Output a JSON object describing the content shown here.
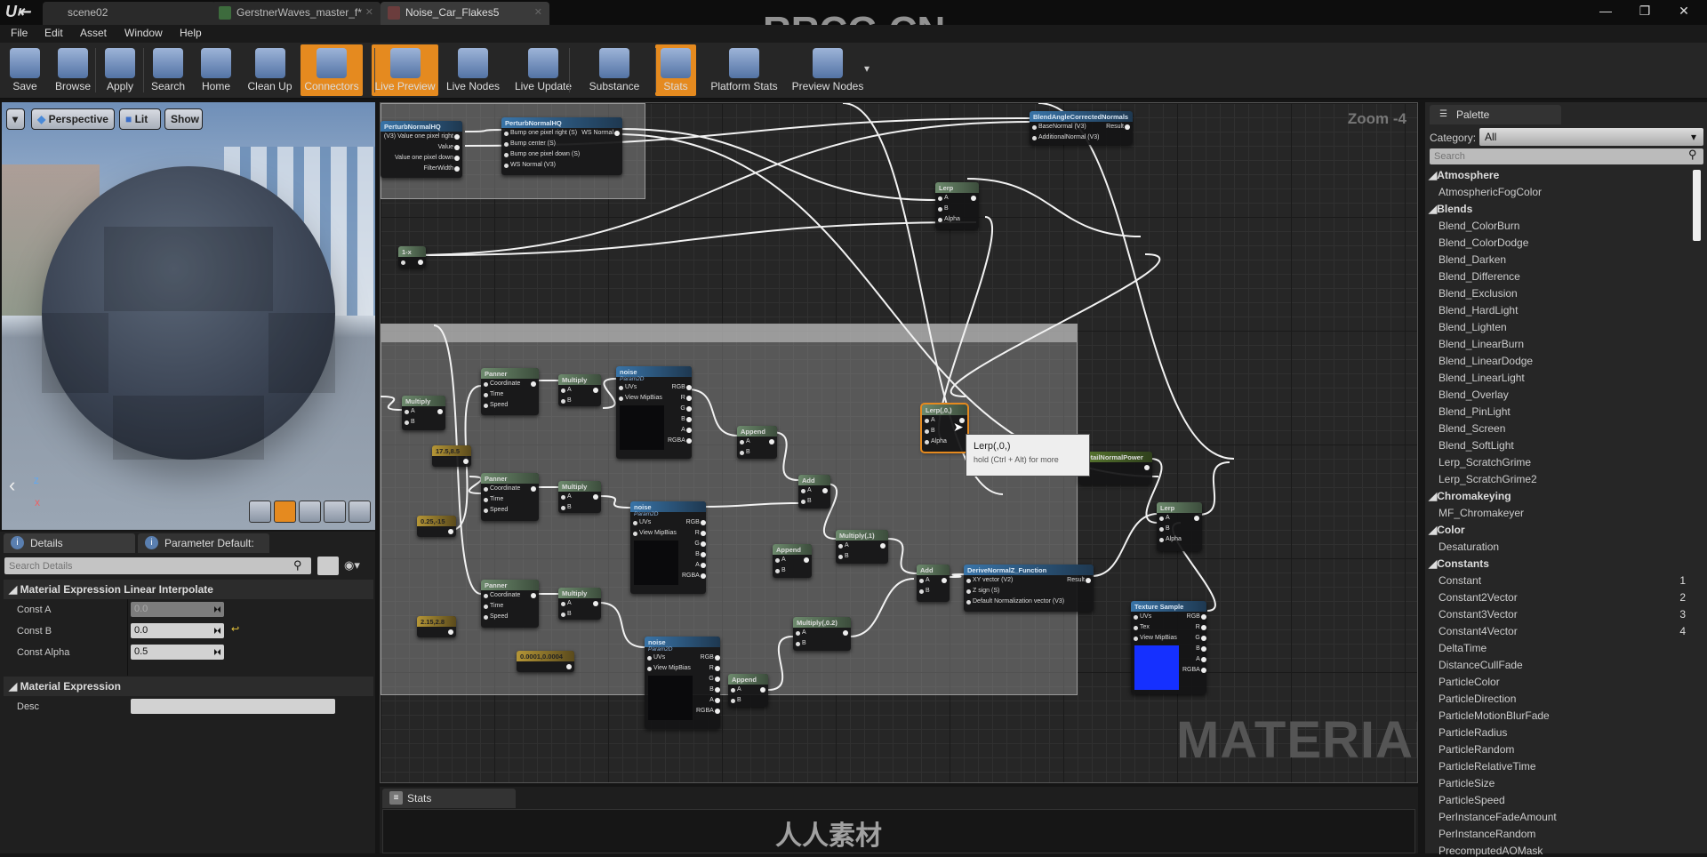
{
  "tabs": [
    {
      "label": "scene02"
    },
    {
      "label": "GerstnerWaves_master_f*"
    },
    {
      "label": "Noise_Car_Flakes5"
    }
  ],
  "window_controls": {
    "minimize": "—",
    "restore": "❐",
    "close": "✕"
  },
  "menu": [
    "File",
    "Edit",
    "Asset",
    "Window",
    "Help"
  ],
  "toolbar": [
    {
      "label": "Save",
      "icon": "save-icon",
      "active": false
    },
    {
      "label": "Browse",
      "icon": "browse-icon",
      "active": false
    },
    {
      "label": "Apply",
      "icon": "apply-check-icon",
      "active": false
    },
    {
      "label": "Search",
      "icon": "binoculars-icon",
      "active": false
    },
    {
      "label": "Home",
      "icon": "home-icon",
      "active": false
    },
    {
      "label": "Clean Up",
      "icon": "broom-icon",
      "active": false
    },
    {
      "label": "Connectors",
      "icon": "connectors-icon",
      "active": true
    },
    {
      "label": "Live Preview",
      "icon": "tv-check-icon",
      "active": true
    },
    {
      "label": "Live Nodes",
      "icon": "live-nodes-icon",
      "active": false
    },
    {
      "label": "Live Update",
      "icon": "live-update-icon",
      "active": false
    },
    {
      "label": "Substance",
      "icon": "substance-icon",
      "active": false
    },
    {
      "label": "Stats",
      "icon": "stats-icon",
      "active": true
    },
    {
      "label": "Platform Stats",
      "icon": "platform-stats-icon",
      "active": false
    },
    {
      "label": "Preview Nodes",
      "icon": "preview-nodes-icon",
      "active": false
    }
  ],
  "viewport": {
    "perspective": "Perspective",
    "lit": "Lit",
    "show": "Show",
    "axis": {
      "z": "Z",
      "x": "X"
    }
  },
  "details": {
    "tabs": [
      "Details",
      "Parameter Default:"
    ],
    "search_placeholder": "Search Details",
    "section1": "Material Expression Linear Interpolate",
    "rows": [
      {
        "label": "Const A",
        "value": "0.0"
      },
      {
        "label": "Const B",
        "value": "0.0"
      },
      {
        "label": "Const Alpha",
        "value": "0.5"
      }
    ],
    "section2": "Material Expression",
    "desc_label": "Desc",
    "desc_value": ""
  },
  "graph": {
    "zoom": "Zoom -4",
    "watermark_type": "MATERIAL",
    "tooltip": {
      "title": "Lerp(,0,)",
      "hint": "hold (Ctrl + Alt) for more"
    },
    "nodes": [
      {
        "title": "PerturbNormalHQ",
        "kind": "func",
        "in": [],
        "out": [
          "(V3)  Value one pixel right",
          "Value",
          "Value one pixel down",
          "FilterWidth"
        ]
      },
      {
        "title": "PerturbNormalHQ",
        "kind": "func",
        "in": [
          "Bump one pixel right (S)",
          "Bump center (S)",
          "Bump one pixel down (S)",
          "WS Normal (V3)"
        ],
        "out": [
          "WS Normal"
        ]
      },
      {
        "title": "BlendAngleCorrectedNormals",
        "kind": "func",
        "in": [
          "BaseNormal (V3)",
          "AdditionalNormal (V3)"
        ],
        "out": [
          "Result"
        ]
      },
      {
        "title": "Lerp",
        "kind": "math",
        "in": [
          "A",
          "B",
          "Alpha"
        ],
        "out": [
          ""
        ]
      },
      {
        "title": "1-x",
        "kind": "math",
        "in": [
          ""
        ],
        "out": [
          ""
        ]
      },
      {
        "title": "Multiply",
        "kind": "math",
        "in": [
          "A",
          "B"
        ],
        "out": [
          ""
        ]
      },
      {
        "title": "Panner",
        "kind": "math",
        "in": [
          "Coordinate",
          "Time",
          "Speed"
        ],
        "out": [
          ""
        ]
      },
      {
        "title": "Multiply",
        "kind": "math",
        "in": [
          "A",
          "B"
        ],
        "out": [
          ""
        ]
      },
      {
        "title": "noise",
        "sub": "Param2D",
        "kind": "func",
        "preview": true,
        "in": [
          "UVs",
          "View MipBias"
        ],
        "out": [
          "RGB",
          "R",
          "G",
          "B",
          "A",
          "RGBA"
        ]
      },
      {
        "title": "17.5,8.5",
        "kind": "const",
        "in": [],
        "out": [
          ""
        ]
      },
      {
        "title": "Append",
        "kind": "math",
        "in": [
          "A",
          "B"
        ],
        "out": [
          ""
        ]
      },
      {
        "title": "Panner",
        "kind": "math",
        "in": [
          "Coordinate",
          "Time",
          "Speed"
        ],
        "out": [
          ""
        ]
      },
      {
        "title": "Multiply",
        "kind": "math",
        "in": [
          "A",
          "B"
        ],
        "out": [
          ""
        ]
      },
      {
        "title": "0.25,-15",
        "kind": "const",
        "in": [],
        "out": [
          ""
        ]
      },
      {
        "title": "noise",
        "sub": "Param2D",
        "kind": "func",
        "preview": true,
        "in": [
          "UVs",
          "View MipBias"
        ],
        "out": [
          "RGB",
          "R",
          "G",
          "B",
          "A",
          "RGBA"
        ]
      },
      {
        "title": "Add",
        "kind": "math",
        "in": [
          "A",
          "B"
        ],
        "out": [
          ""
        ]
      },
      {
        "title": "Multiply(,1)",
        "kind": "math",
        "in": [
          "A",
          "B"
        ],
        "out": [
          ""
        ]
      },
      {
        "title": "Append",
        "kind": "math",
        "in": [
          "A",
          "B"
        ],
        "out": [
          ""
        ]
      },
      {
        "title": "Panner",
        "kind": "math",
        "in": [
          "Coordinate",
          "Time",
          "Speed"
        ],
        "out": [
          ""
        ]
      },
      {
        "title": "Multiply",
        "kind": "math",
        "in": [
          "A",
          "B"
        ],
        "out": [
          ""
        ]
      },
      {
        "title": "2.15,2.8",
        "kind": "const",
        "in": [],
        "out": [
          ""
        ]
      },
      {
        "title": "0.0001,0.0004",
        "kind": "const",
        "in": [],
        "out": [
          ""
        ]
      },
      {
        "title": "noise",
        "sub": "Param2D",
        "kind": "func",
        "preview": true,
        "in": [
          "UVs",
          "View MipBias"
        ],
        "out": [
          "RGB",
          "R",
          "G",
          "B",
          "A",
          "RGBA"
        ]
      },
      {
        "title": "Append",
        "kind": "math",
        "in": [
          "A",
          "B"
        ],
        "out": [
          ""
        ]
      },
      {
        "title": "Multiply(,0.2)",
        "kind": "math",
        "in": [
          "A",
          "B"
        ],
        "out": [
          ""
        ]
      },
      {
        "title": "Add",
        "kind": "math",
        "in": [
          "A",
          "B"
        ],
        "out": [
          ""
        ]
      },
      {
        "title": "Lerp(,0,)",
        "kind": "math",
        "selected": true,
        "in": [
          "A",
          "B",
          "Alpha"
        ],
        "out": [
          ""
        ]
      },
      {
        "title": "DetailNormalPower",
        "kind": "param",
        "in": [],
        "out": [
          ""
        ]
      },
      {
        "title": "Lerp",
        "kind": "math",
        "in": [
          "A",
          "B",
          "Alpha"
        ],
        "out": [
          ""
        ]
      },
      {
        "title": "DeriveNormalZ_Function",
        "kind": "func",
        "in": [
          "XY vector (V2)",
          "Z sign (S)",
          "Default Normalization vector (V3)"
        ],
        "out": [
          "Result"
        ]
      },
      {
        "title": "Texture Sample",
        "kind": "func",
        "preview": true,
        "preview_color": "#1530ff",
        "in": [
          "UVs",
          "Tex",
          "View MipBias"
        ],
        "out": [
          "RGB",
          "R",
          "G",
          "B",
          "A",
          "RGBA"
        ]
      }
    ]
  },
  "stats": {
    "tab": "Stats"
  },
  "palette": {
    "tab": "Palette",
    "category_label": "Category:",
    "category_value": "All",
    "search_placeholder": "Search",
    "groups": [
      {
        "name": "Atmosphere",
        "items": [
          {
            "label": "AtmosphericFogColor"
          }
        ]
      },
      {
        "name": "Blends",
        "items": [
          {
            "label": "Blend_ColorBurn"
          },
          {
            "label": "Blend_ColorDodge"
          },
          {
            "label": "Blend_Darken"
          },
          {
            "label": "Blend_Difference"
          },
          {
            "label": "Blend_Exclusion"
          },
          {
            "label": "Blend_HardLight"
          },
          {
            "label": "Blend_Lighten"
          },
          {
            "label": "Blend_LinearBurn"
          },
          {
            "label": "Blend_LinearDodge"
          },
          {
            "label": "Blend_LinearLight"
          },
          {
            "label": "Blend_Overlay"
          },
          {
            "label": "Blend_PinLight"
          },
          {
            "label": "Blend_Screen"
          },
          {
            "label": "Blend_SoftLight"
          },
          {
            "label": "Lerp_ScratchGrime"
          },
          {
            "label": "Lerp_ScratchGrime2"
          }
        ]
      },
      {
        "name": "Chromakeying",
        "items": [
          {
            "label": "MF_Chromakeyer"
          }
        ]
      },
      {
        "name": "Color",
        "items": [
          {
            "label": "Desaturation"
          }
        ]
      },
      {
        "name": "Constants",
        "items": [
          {
            "label": "Constant",
            "key": "1"
          },
          {
            "label": "Constant2Vector",
            "key": "2"
          },
          {
            "label": "Constant3Vector",
            "key": "3"
          },
          {
            "label": "Constant4Vector",
            "key": "4"
          },
          {
            "label": "DeltaTime"
          },
          {
            "label": "DistanceCullFade"
          },
          {
            "label": "ParticleColor"
          },
          {
            "label": "ParticleDirection"
          },
          {
            "label": "ParticleMotionBlurFade"
          },
          {
            "label": "ParticleRadius"
          },
          {
            "label": "ParticleRandom"
          },
          {
            "label": "ParticleRelativeTime"
          },
          {
            "label": "ParticleSize"
          },
          {
            "label": "ParticleSpeed"
          },
          {
            "label": "PerInstanceFadeAmount"
          },
          {
            "label": "PerInstanceRandom"
          },
          {
            "label": "PrecomputedAOMask"
          }
        ]
      }
    ]
  },
  "watermarks": [
    "RRCG.CN",
    "人人素材"
  ],
  "colors": {
    "accent": "#e58a1f",
    "graph_bg": "#262626",
    "panel_bg": "#262626"
  }
}
